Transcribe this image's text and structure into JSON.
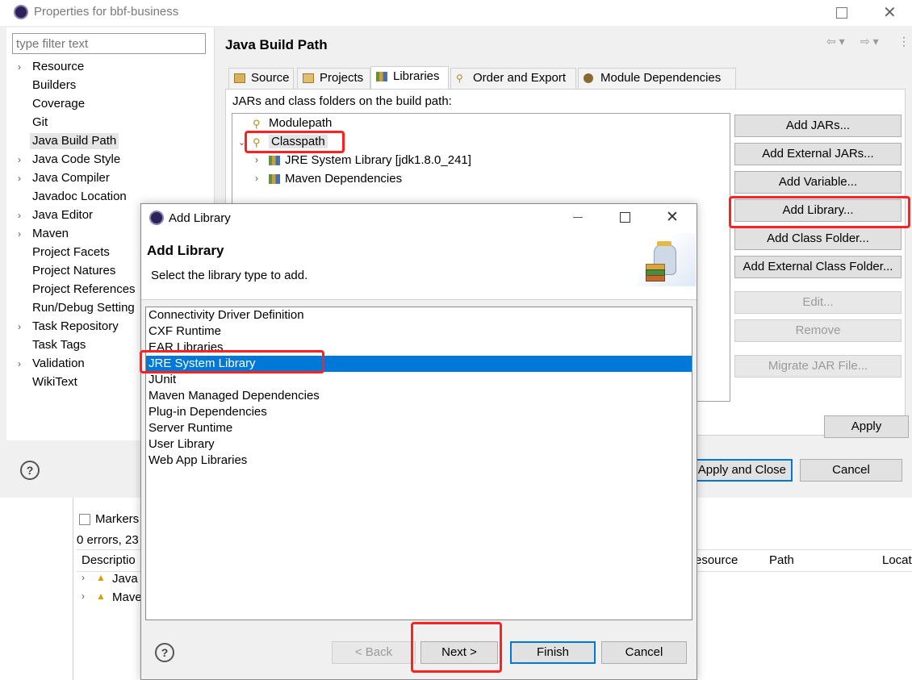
{
  "properties": {
    "title": "Properties for bbf-business",
    "filter_placeholder": "type filter text",
    "nav": [
      {
        "label": "Resource",
        "expandable": true
      },
      {
        "label": "Builders",
        "expandable": false
      },
      {
        "label": "Coverage",
        "expandable": false
      },
      {
        "label": "Git",
        "expandable": false
      },
      {
        "label": "Java Build Path",
        "expandable": false,
        "selected": true
      },
      {
        "label": "Java Code Style",
        "expandable": true
      },
      {
        "label": "Java Compiler",
        "expandable": true
      },
      {
        "label": "Javadoc Location",
        "expandable": false
      },
      {
        "label": "Java Editor",
        "expandable": true
      },
      {
        "label": "Maven",
        "expandable": true
      },
      {
        "label": "Project Facets",
        "expandable": false
      },
      {
        "label": "Project Natures",
        "expandable": false
      },
      {
        "label": "Project References",
        "expandable": false
      },
      {
        "label": "Run/Debug Setting",
        "expandable": false
      },
      {
        "label": "Task Repository",
        "expandable": true
      },
      {
        "label": "Task Tags",
        "expandable": false
      },
      {
        "label": "Validation",
        "expandable": true
      },
      {
        "label": "WikiText",
        "expandable": false
      }
    ],
    "page_title": "Java Build Path",
    "tabs": [
      "Source",
      "Projects",
      "Libraries",
      "Order and Export",
      "Module Dependencies"
    ],
    "active_tab": "Libraries",
    "jars_label": "JARs and class folders on the build path:",
    "tree": {
      "modulepath": "Modulepath",
      "classpath": "Classpath",
      "children": [
        "JRE System Library [jdk1.8.0_241]",
        "Maven Dependencies"
      ]
    },
    "side_buttons": {
      "add_jars": "Add JARs...",
      "add_external_jars": "Add External JARs...",
      "add_variable": "Add Variable...",
      "add_library": "Add Library...",
      "add_class_folder": "Add Class Folder...",
      "add_external_class_folder": "Add External Class Folder...",
      "edit": "Edit...",
      "remove": "Remove",
      "migrate": "Migrate JAR File..."
    },
    "apply": "Apply",
    "apply_and_close": "Apply and Close",
    "cancel": "Cancel"
  },
  "background": {
    "markers_tab": "Markers",
    "errors_summary": "0 errors, 23",
    "columns": {
      "description": "Descriptio",
      "resource": "esource",
      "path": "Path",
      "location": "Locat"
    },
    "rows": [
      "Java I",
      "Mave"
    ]
  },
  "dialog": {
    "title": "Add Library",
    "heading": "Add Library",
    "subtitle": "Select the library type to add.",
    "libraries": [
      "Connectivity Driver Definition",
      "CXF Runtime",
      "EAR Libraries",
      "JRE System Library",
      "JUnit",
      "Maven Managed Dependencies",
      "Plug-in Dependencies",
      "Server Runtime",
      "User Library",
      "Web App Libraries"
    ],
    "selected_library": "JRE System Library",
    "buttons": {
      "back": "< Back",
      "next": "Next >",
      "finish": "Finish",
      "cancel": "Cancel"
    }
  },
  "colors": {
    "selection": "#0078d7",
    "highlight": "#ff2020",
    "nav_selected": "#e5e5e5"
  }
}
